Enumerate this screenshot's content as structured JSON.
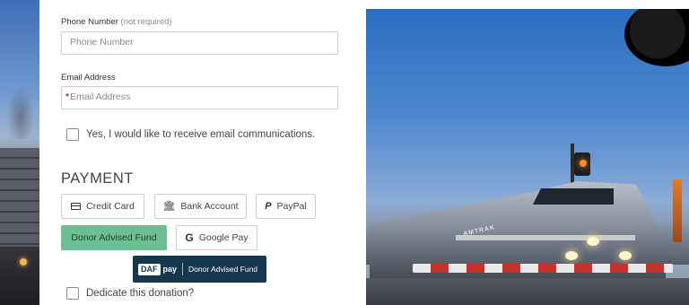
{
  "contact": {
    "phone_label": "Phone Number",
    "phone_note": "(not required)",
    "phone_placeholder": "Phone Number",
    "email_label": "Email Address",
    "email_required_mark": "*",
    "email_placeholder": "Email Address",
    "email_optin_label": "Yes, I would like to receive email communications."
  },
  "payment": {
    "title": "PAYMENT",
    "methods": [
      {
        "label": "Credit Card",
        "icon": "credit-card-icon"
      },
      {
        "label": "Bank Account",
        "icon": "bank-icon"
      },
      {
        "label": "PayPal",
        "icon": "paypal-icon"
      },
      {
        "label": "Donor Advised Fund",
        "icon": "",
        "selected": true
      },
      {
        "label": "Google Pay",
        "icon": "google-icon"
      }
    ],
    "daf_button": {
      "badge": "DAF",
      "pay": "pay",
      "text": "Donor Advised Fund"
    }
  },
  "dedicate_label": "Dedicate this donation?",
  "colors": {
    "selected_method": "#6cbf93",
    "daf_button_bg": "#15384f",
    "required_star": "#d52b2b"
  }
}
